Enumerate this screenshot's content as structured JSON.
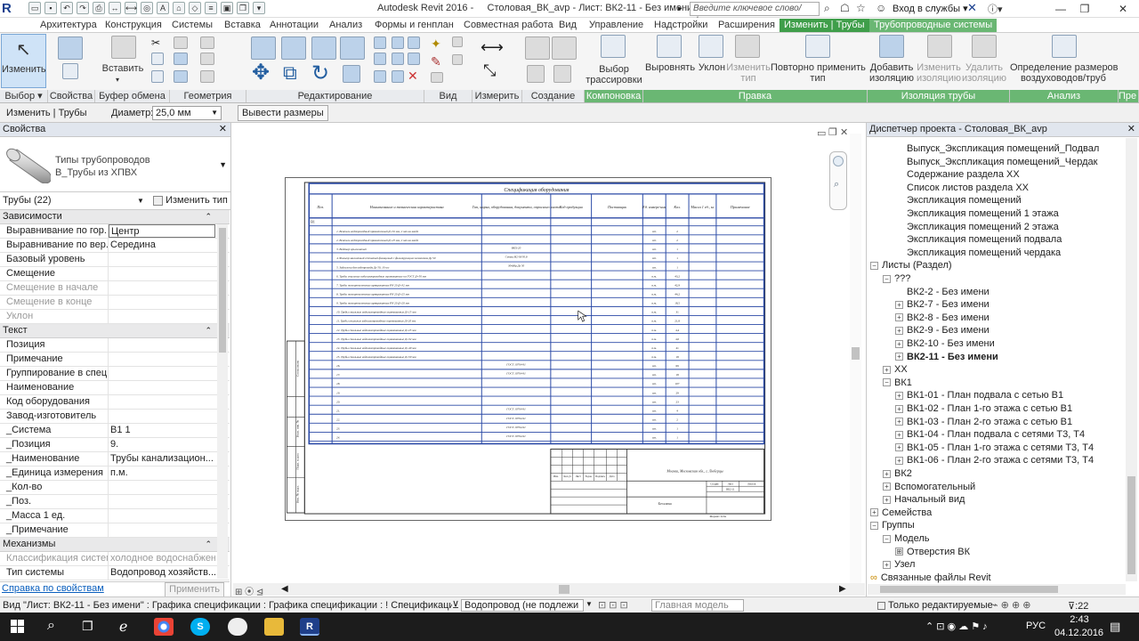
{
  "window": {
    "app_title": "Autodesk Revit 2016 -",
    "doc_title": "Столовая_ВК_avp - Лист: ВК2-11 - Без имени",
    "search_placeholder": "Введите ключевое слово/фразу",
    "login": "Вход в службы",
    "logo": "R"
  },
  "ribbon_tabs": [
    {
      "label": "Архитектура"
    },
    {
      "label": "Конструкция"
    },
    {
      "label": "Системы"
    },
    {
      "label": "Вставка"
    },
    {
      "label": "Аннотации"
    },
    {
      "label": "Анализ"
    },
    {
      "label": "Формы и генплан"
    },
    {
      "label": "Совместная работа"
    },
    {
      "label": "Вид"
    },
    {
      "label": "Управление"
    },
    {
      "label": "Надстройки"
    },
    {
      "label": "Расширения"
    },
    {
      "label": "Изменить | Трубы"
    },
    {
      "label": "Трубопроводные системы"
    }
  ],
  "ribbon": {
    "buttons": {
      "modify": "Изменить",
      "paste": "Вставить",
      "layout_path": "Выбор\nтрассировки",
      "justify": "Выровнять",
      "slope": "Уклон",
      "change_type": "Изменить\nтип",
      "reapply_type": "Повторно применить\nтип",
      "add_insulation": "Добавить\nизоляцию",
      "edit_insulation": "Изменить\nизоляцию",
      "remove_insulation": "Удалить\nизоляцию",
      "duct_sizing": "Определение размеров\nвоздуховодов/труб"
    },
    "panels": {
      "select": "Выбор ▾",
      "properties": "Свойства",
      "clipboard": "Буфер обмена",
      "geometry": "Геометрия",
      "modify": "Редактирование",
      "view": "Вид",
      "measure": "Измерить",
      "create": "Создание",
      "layout": "Компоновка",
      "edit": "Правка",
      "insulation": "Изоляция трубы",
      "analysis": "Анализ",
      "pre": "Пре"
    }
  },
  "options_bar": {
    "context": "Изменить | Трубы",
    "diameter_label": "Диаметр:",
    "diameter_value": "25,0 мм",
    "show_dims": "Вывести размеры"
  },
  "properties": {
    "title": "Свойства",
    "type_family": "Типы трубопроводов",
    "type_name": "В_Трубы из ХПВХ",
    "instance_filter": "Трубы (22)",
    "edit_type": "Изменить тип",
    "categories": {
      "constraints": "Зависимости",
      "text": "Текст",
      "mechanical": "Механизмы"
    },
    "constraints_rows": [
      {
        "k": "Выравнивание по гор...",
        "v": "Центр"
      },
      {
        "k": "Выравнивание по вер...",
        "v": "Середина"
      },
      {
        "k": "Базовый уровень",
        "v": ""
      },
      {
        "k": "Смещение",
        "v": ""
      },
      {
        "k": "Смещение в начале",
        "v": ""
      },
      {
        "k": "Смещение в конце",
        "v": ""
      },
      {
        "k": "Уклон",
        "v": ""
      }
    ],
    "text_rows": [
      {
        "k": "Позиция",
        "v": ""
      },
      {
        "k": "Примечание",
        "v": ""
      },
      {
        "k": "Группирование в спец...",
        "v": ""
      },
      {
        "k": "Наименование",
        "v": ""
      },
      {
        "k": "Код оборудования",
        "v": ""
      },
      {
        "k": "Завод-изготовитель",
        "v": ""
      },
      {
        "k": "_Система",
        "v": "В1 1"
      },
      {
        "k": "_Позиция",
        "v": "9."
      },
      {
        "k": "_Наименование",
        "v": "Трубы канализацион..."
      },
      {
        "k": "_Единица измерения",
        "v": "п.м."
      },
      {
        "k": "_Кол-во",
        "v": ""
      },
      {
        "k": "_Поз.",
        "v": ""
      },
      {
        "k": "_Масса 1 ед.",
        "v": ""
      },
      {
        "k": "_Примечание",
        "v": ""
      }
    ],
    "mech_rows": [
      {
        "k": "Классификация систем",
        "v": "холодное водоснабжен..."
      },
      {
        "k": "Тип системы",
        "v": "Водопровод хозяйств..."
      }
    ],
    "help_link": "Справка по свойствам",
    "apply": "Применить"
  },
  "sheet": {
    "spec_title": "Спецификация оборудования",
    "col_headers": [
      "Поз.",
      "Наименование и техническая характеристика",
      "Тип, марка, оборудования, документа, опросного листа",
      "Код продукции",
      "Поставщик",
      "Ед. измере-ния",
      "Кол.",
      "Масса 1 ед., кг",
      "Примечание"
    ],
    "section": "В1",
    "rows": [
      {
        "name": "1. Вентиль водопроводный прямоточный Д=32 мм, 2 шт на вводе",
        "mark": "",
        "unit": "шт.",
        "qty": "2"
      },
      {
        "name": "2. Вентиль водопроводный прямоточный Д=25 мм, 2 шт на вводе",
        "mark": "",
        "unit": "шт.",
        "qty": "2"
      },
      {
        "name": "3. Водомер крыльчатый",
        "mark": "ВКХ-20",
        "unit": "шт.",
        "qty": "1"
      },
      {
        "name": "4. Фильтр магнитный сетчатый фланцевый с фильтрующим элементом Ду 50",
        "mark": "Сетка М2-М-50.8",
        "unit": "шт.",
        "qty": "1"
      },
      {
        "name": "5. Задвижка для водопровода Ду 50, 16 кгс",
        "mark": "30ч6бр Ду 50",
        "unit": "шт.",
        "qty": "1"
      },
      {
        "name": "6. Трубы стальные водогазопроводные оцинкованные по ГОСТ Д=50 мм",
        "mark": "",
        "unit": "п.м.",
        "qty": "43,2"
      },
      {
        "name": "7. Трубы полипропиленовые армированные PN 20 Д=32 мм",
        "mark": "",
        "unit": "п.м.",
        "qty": "42,9"
      },
      {
        "name": "8. Трубы полипропиленовые армированные PN 20 Д=25 мм",
        "mark": "",
        "unit": "п.м.",
        "qty": "44,2"
      },
      {
        "name": "9. Трубы полипропиленовые армированные PN 20 Д=20 мм",
        "mark": "",
        "unit": "п.м.",
        "qty": "18,5"
      },
      {
        "name": "10. Трубы стальные водогазопроводные оцинкованные Д=15 мм",
        "mark": "",
        "unit": "п.м.",
        "qty": "31"
      },
      {
        "name": "11. Трубы стальные водогазопроводные оцинкованные Д=20 мм",
        "mark": "",
        "unit": "п.м.",
        "qty": "21,8"
      },
      {
        "name": "12. Трубы стальные водогазопроводные оцинкованные Д=25 мм",
        "mark": "",
        "unit": "п.м.",
        "qty": "4,4"
      },
      {
        "name": "13. Трубы стальные водогазопроводные оцинкованные Д=32 мм",
        "mark": "",
        "unit": "п.м.",
        "qty": "4,0"
      },
      {
        "name": "14. Трубы стальные водогазопроводные оцинкованные Д=40 мм",
        "mark": "",
        "unit": "п.м.",
        "qty": "41"
      },
      {
        "name": "15. Трубы стальные водогазопроводные оцинкованные Д=50 мм",
        "mark": "",
        "unit": "п.м.",
        "qty": "18"
      },
      {
        "name": "16.",
        "mark": "ГОСТ 10704-91",
        "unit": "шт.",
        "qty": "69"
      },
      {
        "name": "17.",
        "mark": "ГОСТ 10704-91",
        "unit": "шт.",
        "qty": "18"
      },
      {
        "name": "18.",
        "mark": "",
        "unit": "шт.",
        "qty": "107"
      },
      {
        "name": "19.",
        "mark": "",
        "unit": "шт.",
        "qty": "29"
      },
      {
        "name": "20.",
        "mark": "",
        "unit": "шт.",
        "qty": "23"
      },
      {
        "name": "21.",
        "mark": "ГОСТ 10704-91",
        "unit": "шт.",
        "qty": "4"
      },
      {
        "name": "22.",
        "mark": "ГОСТ 10704-91",
        "unit": "шт.",
        "qty": "2"
      },
      {
        "name": "23.",
        "mark": "ГОСТ 10704-91",
        "unit": "шт.",
        "qty": "1"
      },
      {
        "name": "24.",
        "mark": "ГОСТ 10704-91",
        "unit": "шт.",
        "qty": "1"
      }
    ],
    "stamp_location": "Москва, Московская обл., г. Люберцы",
    "stamp_stage": "Стадия",
    "stamp_sheet": "Лист",
    "stamp_sheets": "Листов",
    "stamp_sheet_no": "ВК2-11",
    "stamp_name": "Без имени",
    "stamp_format": "Формат А3А",
    "stamp_cols": [
      "Изм.",
      "Кол.уч",
      "Лист",
      "№док.",
      "Подпись",
      "Дата"
    ],
    "side_labels": [
      "Согласовано",
      "Взам. инв. №",
      "Подп. и дата",
      "Инв. № подл."
    ]
  },
  "project_browser": {
    "title": "Диспетчер проекта - Столовая_ВК_avp",
    "items": [
      {
        "label": "Выпуск_Экспликация помещений_Подвал",
        "level": 2,
        "exp": ""
      },
      {
        "label": "Выпуск_Экспликация помещений_Чердак",
        "level": 2,
        "exp": ""
      },
      {
        "label": "Содержание раздела XX",
        "level": 2,
        "exp": ""
      },
      {
        "label": "Список листов раздела XX",
        "level": 2,
        "exp": ""
      },
      {
        "label": "Экспликация помещений",
        "level": 2,
        "exp": ""
      },
      {
        "label": "Экспликация помещений 1 этажа",
        "level": 2,
        "exp": ""
      },
      {
        "label": "Экспликация помещений 2 этажа",
        "level": 2,
        "exp": ""
      },
      {
        "label": "Экспликация помещений подвала",
        "level": 2,
        "exp": ""
      },
      {
        "label": "Экспликация помещений чердака",
        "level": 2,
        "exp": ""
      },
      {
        "label": "Листы (Раздел)",
        "level": 0,
        "exp": "−"
      },
      {
        "label": "???",
        "level": 1,
        "exp": "−"
      },
      {
        "label": "ВК2-2 - Без имени",
        "level": 2,
        "exp": ""
      },
      {
        "label": "ВК2-7 - Без имени",
        "level": 2,
        "exp": "+"
      },
      {
        "label": "ВК2-8 - Без имени",
        "level": 2,
        "exp": "+"
      },
      {
        "label": "ВК2-9 - Без имени",
        "level": 2,
        "exp": "+"
      },
      {
        "label": "ВК2-10 - Без имени",
        "level": 2,
        "exp": "+"
      },
      {
        "label": "ВК2-11 - Без имени",
        "level": 2,
        "exp": "+",
        "bold": true
      },
      {
        "label": "XX",
        "level": 1,
        "exp": "+"
      },
      {
        "label": "ВК1",
        "level": 1,
        "exp": "−"
      },
      {
        "label": "ВК1-01 - План подвала с сетью В1",
        "level": 2,
        "exp": "+"
      },
      {
        "label": "ВК1-02 - План 1-го этажа с сетью В1",
        "level": 2,
        "exp": "+"
      },
      {
        "label": "ВК1-03 - План 2-го этажа с сетью В1",
        "level": 2,
        "exp": "+"
      },
      {
        "label": "ВК1-04 - План подвала с сетями Т3, Т4",
        "level": 2,
        "exp": "+"
      },
      {
        "label": "ВК1-05 - План 1-го этажа с сетями Т3, Т4",
        "level": 2,
        "exp": "+"
      },
      {
        "label": "ВК1-06 - План 2-го этажа с сетями Т3, Т4",
        "level": 2,
        "exp": "+"
      },
      {
        "label": "ВК2",
        "level": 1,
        "exp": "+"
      },
      {
        "label": "Вспомогательный",
        "level": 1,
        "exp": "+"
      },
      {
        "label": "Начальный вид",
        "level": 1,
        "exp": "+"
      },
      {
        "label": "Семейства",
        "level": 0,
        "exp": "+"
      },
      {
        "label": "Группы",
        "level": 0,
        "exp": "−"
      },
      {
        "label": "Модель",
        "level": 1,
        "exp": "−"
      },
      {
        "label": "Отверстия ВК",
        "level": 2,
        "exp": "[0]"
      },
      {
        "label": "Узел",
        "level": 1,
        "exp": "+"
      },
      {
        "label": "Связанные файлы Revit",
        "level": 0,
        "exp": "∞"
      }
    ]
  },
  "status": {
    "text": "Вид \"Лист: ВК2-11 - Без имени\" : Графика спецификации : Графика спецификации : ! Спецификация ВК в1 ч",
    "system": "Водопровод (не подлежи",
    "model": "Главная модель",
    "editable_only": "Только редактируемые",
    "filter_count": ":22"
  },
  "taskbar": {
    "lang": "РУС",
    "time": "2:43",
    "date": "04.12.2016"
  },
  "colors": {
    "context_tab": "#3f9e4a",
    "sheet_border": "#2b4aa6",
    "link": "#0a5fbe"
  }
}
